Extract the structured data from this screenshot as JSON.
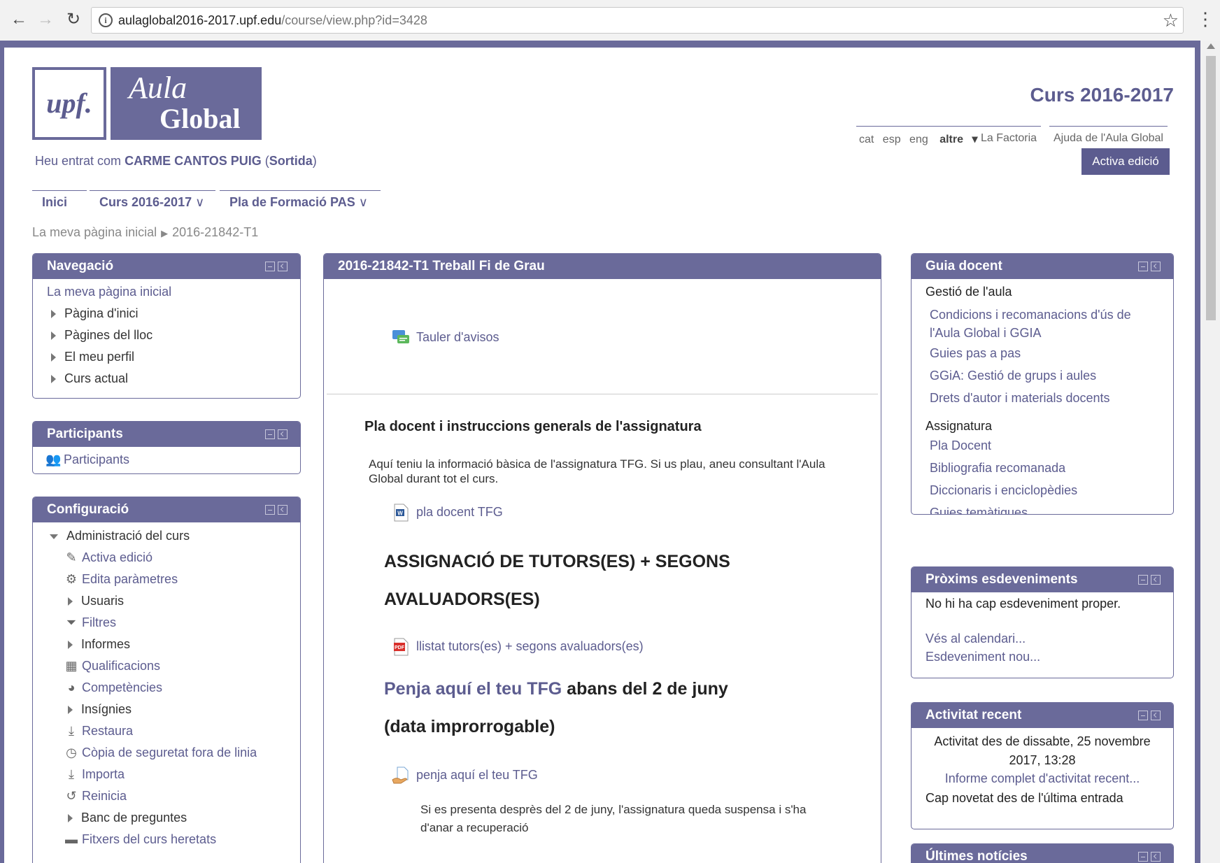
{
  "browser": {
    "url_host": "aulaglobal2016-2017.upf.edu",
    "url_path": "/course/view.php?id=3428"
  },
  "header": {
    "logo_upf": "upf.",
    "logo_aula": "Aula",
    "logo_global": "Global",
    "course_year": "Curs 2016-2017",
    "langs": [
      "cat",
      "esp",
      "eng",
      "altre"
    ],
    "link_factoria": "La Factoria",
    "link_help": "Ajuda de l'Aula Global",
    "edit_button": "Activa edició",
    "login_prefix": "Heu entrat com",
    "login_user": "CARME CANTOS PUIG",
    "login_logout": "Sortida"
  },
  "mainnav": {
    "home": "Inici",
    "course": "Curs 2016-2017",
    "training": "Pla de Formació PAS"
  },
  "breadcrumb": {
    "home": "La meva pàgina inicial",
    "current": "2016-21842-T1"
  },
  "navigation": {
    "title": "Navegació",
    "root": "La meva pàgina inicial",
    "items": [
      "Pàgina d'inici",
      "Pàgines del lloc",
      "El meu perfil",
      "Curs actual"
    ]
  },
  "participants": {
    "title": "Participants",
    "link": "Participants"
  },
  "config": {
    "title": "Configuració",
    "admin": "Administració del curs",
    "items": [
      {
        "label": "Activa edició",
        "icon": "pencil-icon",
        "kind": "link"
      },
      {
        "label": "Edita paràmetres",
        "icon": "gear-icon",
        "kind": "link"
      },
      {
        "label": "Usuaris",
        "icon": "expand-icon",
        "kind": "branch"
      },
      {
        "label": "Filtres",
        "icon": "filter-icon",
        "kind": "link"
      },
      {
        "label": "Informes",
        "icon": "expand-icon",
        "kind": "branch"
      },
      {
        "label": "Qualificacions",
        "icon": "grid-icon",
        "kind": "link"
      },
      {
        "label": "Competències",
        "icon": "competency-icon",
        "kind": "link"
      },
      {
        "label": "Insígnies",
        "icon": "expand-icon",
        "kind": "branch"
      },
      {
        "label": "Restaura",
        "icon": "upload-icon",
        "kind": "link"
      },
      {
        "label": "Còpia de seguretat fora de linia",
        "icon": "clock-icon",
        "kind": "link"
      },
      {
        "label": "Importa",
        "icon": "upload-icon",
        "kind": "link"
      },
      {
        "label": "Reinicia",
        "icon": "reset-icon",
        "kind": "link"
      },
      {
        "label": "Banc de preguntes",
        "icon": "expand-icon",
        "kind": "branch"
      },
      {
        "label": "Fitxers del curs heretats",
        "icon": "folder-icon",
        "kind": "link"
      }
    ]
  },
  "main": {
    "title": "2016-21842-T1 Treball Fi de Grau",
    "forum": "Tauler d'avisos",
    "section_title": "Pla docent i instruccions generals de l'assignatura",
    "intro": "Aquí teniu la informació bàsica de l'assignatura TFG. Si us plau, aneu consultant l'Aula Global durant tot el curs.",
    "doc_link": "pla docent TFG",
    "assign_head_1": "ASSIGNACIÓ DE TUTORS(ES) + SEGONS",
    "assign_head_2": "AVALUADORS(ES)",
    "pdf_link": "llistat tutors(es) + segons avaluadors(es)",
    "upload_head_link": "Penja aquí el teu TFG",
    "upload_head_rest": "abans del 2 de juny",
    "upload_head_2": "(data improrrogable)",
    "assign_link": "penja aquí el teu TFG",
    "note": "Si es presenta desprès del 2 de juny, l'assignatura queda suspensa i s'ha d'anar a recuperació"
  },
  "guide": {
    "title": "Guia docent",
    "group1": "Gestió de l'aula",
    "group1_links": [
      "Condicions i recomanacions d'ús de l'Aula Global i GGIA",
      "Guies pas a pas",
      "GGiA: Gestió de grups i aules",
      "Drets d'autor i materials docents"
    ],
    "group2": "Assignatura",
    "group2_links": [
      "Pla Docent",
      "Bibliografia recomanada",
      "Diccionaris i enciclopèdies",
      "Guies temàtiques"
    ]
  },
  "events": {
    "title": "Pròxims esdeveniments",
    "none": "No hi ha cap esdeveniment proper.",
    "calendar": "Vés al calendari...",
    "new": "Esdeveniment nou..."
  },
  "recent": {
    "title": "Activitat recent",
    "since": "Activitat des de dissabte, 25 novembre 2017, 13:28",
    "report": "Informe complet d'activitat recent...",
    "none": "Cap novetat des de l'última entrada"
  },
  "news": {
    "title": "Últimes notícies"
  }
}
